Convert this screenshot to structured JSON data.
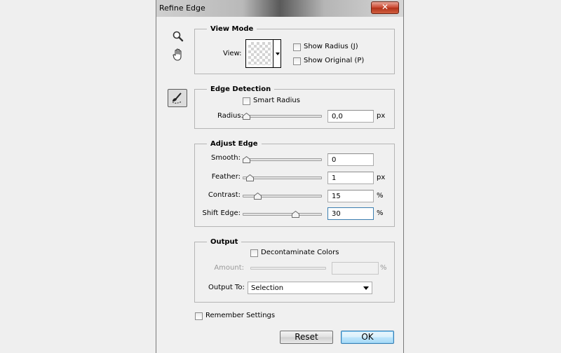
{
  "window": {
    "title": "Refine Edge",
    "close_glyph": "✕"
  },
  "tools": [
    {
      "name": "zoom-icon"
    },
    {
      "name": "hand-icon"
    },
    {
      "name": "refine-radius-brush-icon",
      "selected": true
    }
  ],
  "view_mode": {
    "legend": "View Mode",
    "view_label": "View:",
    "show_radius": "Show Radius (J)",
    "show_original": "Show Original (P)"
  },
  "edge_detection": {
    "legend": "Edge Detection",
    "smart_radius": "Smart Radius",
    "radius_label": "Radius:",
    "radius_value": "0,0",
    "radius_unit": "px"
  },
  "adjust_edge": {
    "legend": "Adjust Edge",
    "smooth_label": "Smooth:",
    "smooth_value": "0",
    "feather_label": "Feather:",
    "feather_value": "1",
    "feather_unit": "px",
    "contrast_label": "Contrast:",
    "contrast_value": "15",
    "contrast_unit": "%",
    "shift_label": "Shift Edge:",
    "shift_value": "30",
    "shift_unit": "%"
  },
  "output": {
    "legend": "Output",
    "decontaminate": "Decontaminate Colors",
    "amount_label": "Amount:",
    "amount_value": "",
    "amount_unit": "%",
    "output_to_label": "Output To:",
    "output_to_value": "Selection"
  },
  "remember_settings": "Remember Settings",
  "buttons": {
    "reset": "Reset",
    "ok": "OK"
  },
  "colors": {
    "focus": "#3c7fb1",
    "close": "#c9452d"
  }
}
